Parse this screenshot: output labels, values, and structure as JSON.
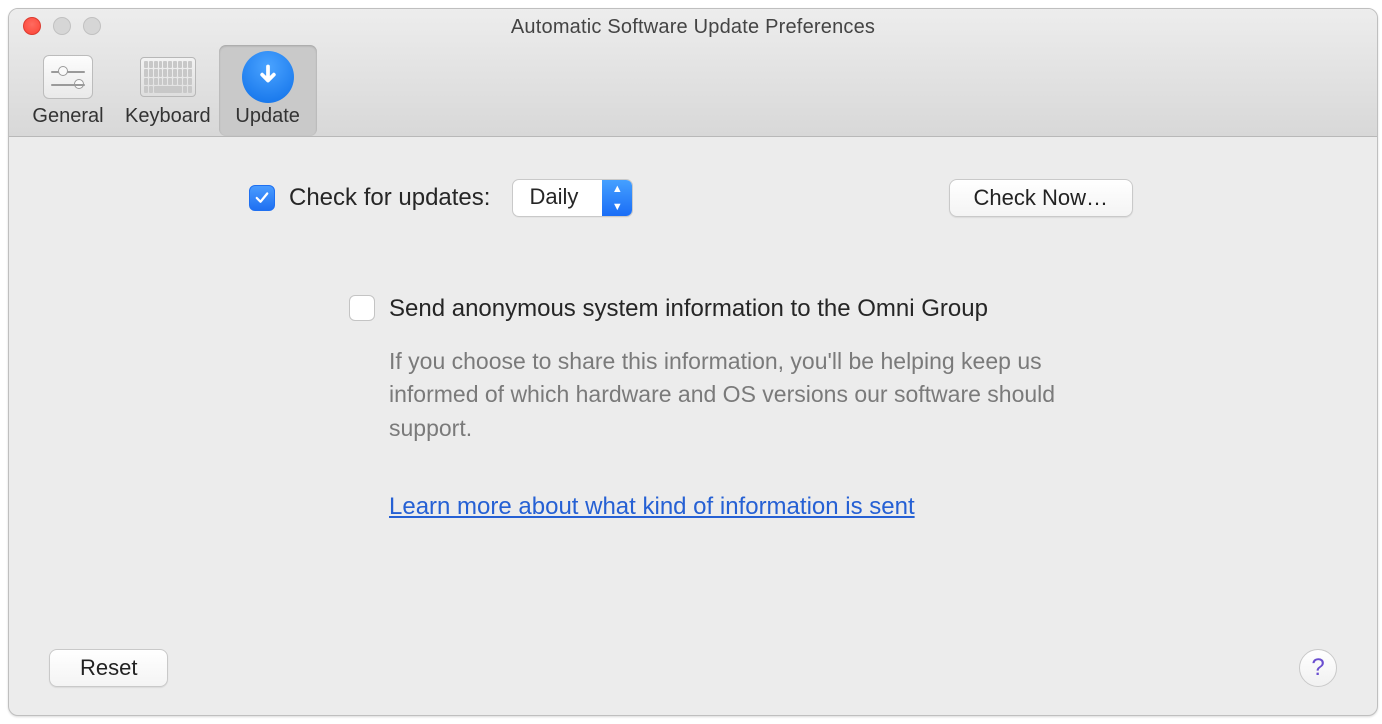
{
  "window": {
    "title": "Automatic Software Update Preferences"
  },
  "toolbar": {
    "items": [
      {
        "id": "general",
        "label": "General",
        "icon": "sliders-icon",
        "selected": false
      },
      {
        "id": "keyboard",
        "label": "Keyboard",
        "icon": "keyboard-icon",
        "selected": false
      },
      {
        "id": "update",
        "label": "Update",
        "icon": "update-icon",
        "selected": true
      }
    ]
  },
  "update_pane": {
    "check_for_updates": {
      "label": "Check for updates:",
      "checked": true,
      "frequency": "Daily"
    },
    "check_now_label": "Check Now…",
    "send_anonymous": {
      "label": "Send anonymous system information to the Omni Group",
      "checked": false
    },
    "description": "If you choose to share this information, you'll be helping keep us informed of which hardware and OS versions our software should support.",
    "learn_more_label": "Learn more about what kind of information is sent"
  },
  "footer": {
    "reset_label": "Reset",
    "help_symbol": "?"
  }
}
